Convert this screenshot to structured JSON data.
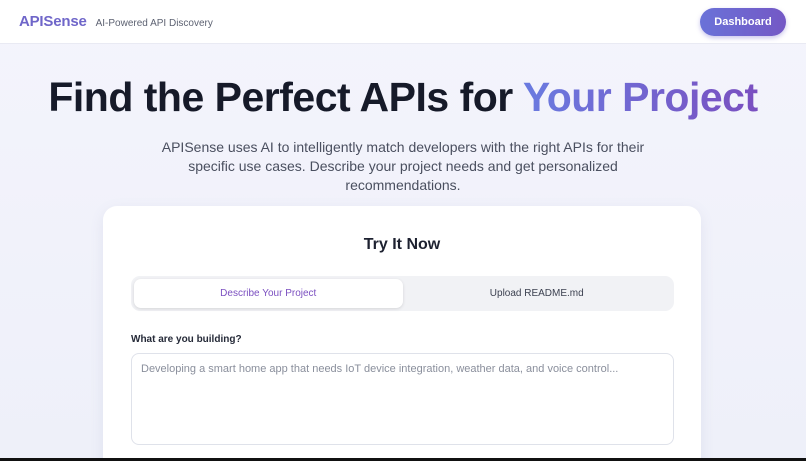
{
  "header": {
    "brand": "APISense",
    "tagline": "AI-Powered API Discovery",
    "dashboard_label": "Dashboard"
  },
  "hero": {
    "title_main": "Find the Perfect APIs for ",
    "title_accent": "Your Project",
    "subtitle": "APISense uses AI to intelligently match developers with the right APIs for their specific use cases. Describe your project needs and get personalized recommendations."
  },
  "try_card": {
    "title": "Try It Now",
    "tabs": [
      {
        "label": "Describe Your Project",
        "active": true
      },
      {
        "label": "Upload README.md",
        "active": false
      }
    ],
    "field_label": "What are you building?",
    "textarea_placeholder": "Developing a smart home app that needs IoT device integration, weather data, and voice control...",
    "textarea_value": ""
  },
  "colors": {
    "brand": "#6f66c9",
    "accent_start": "#6a7be0",
    "accent_end": "#7a4fc0",
    "active_tab_text": "#7b4fc0"
  }
}
